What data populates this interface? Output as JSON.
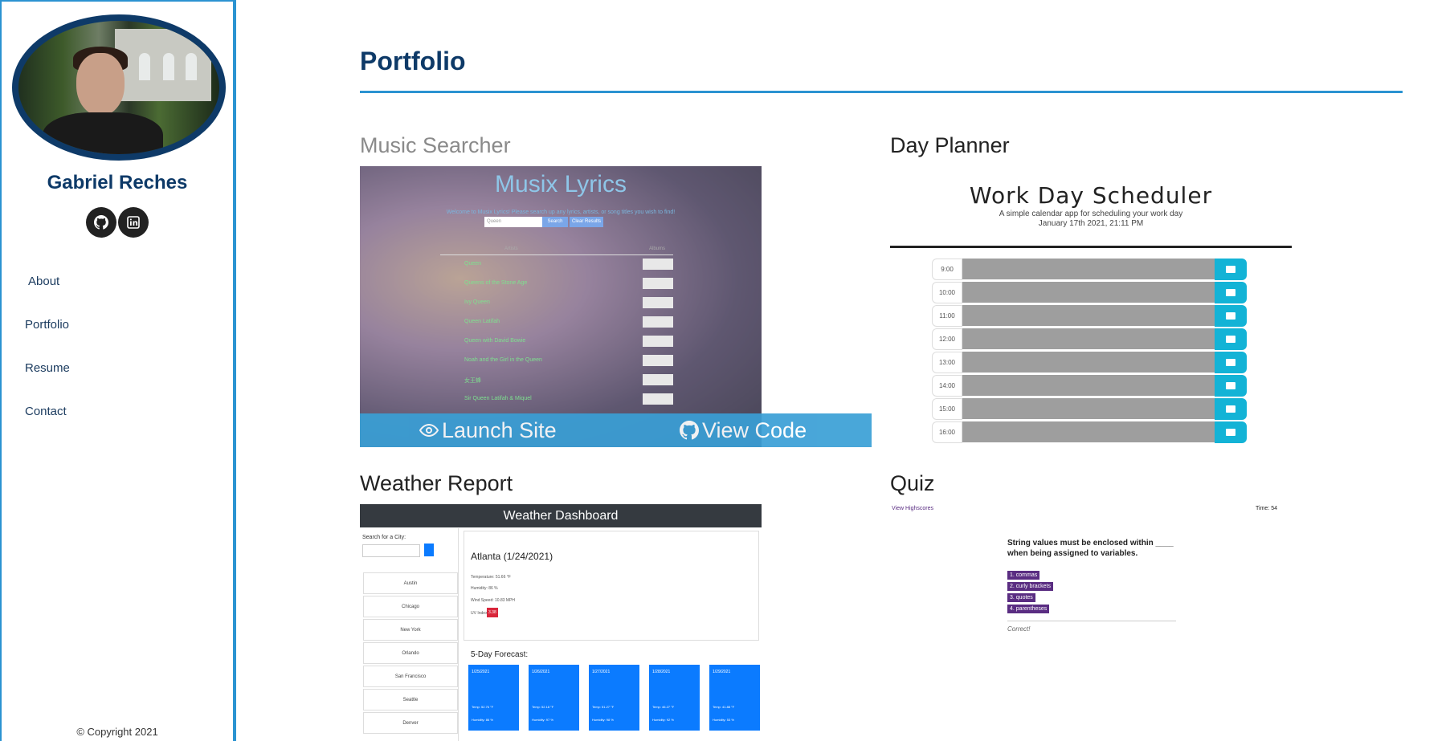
{
  "sidebar": {
    "name": "Gabriel Reches",
    "social": [
      "github-icon",
      "linkedin-icon"
    ],
    "nav": [
      {
        "label": "About"
      },
      {
        "label": "Portfolio"
      },
      {
        "label": "Resume"
      },
      {
        "label": "Contact"
      }
    ],
    "copyright": "© Copyright 2021"
  },
  "main": {
    "title": "Portfolio",
    "projects": [
      {
        "title": "Music Searcher"
      },
      {
        "title": "Day Planner"
      },
      {
        "title": "Weather Report"
      },
      {
        "title": "Quiz"
      }
    ],
    "overlay": {
      "launch_label": "Launch Site",
      "code_label": "View Code"
    }
  },
  "music_thumb": {
    "title": "Musix Lyrics",
    "intro": "Welcome to Musix Lyrics! Please search up any lyrics, artists, or song titles you wish to find!",
    "search_placeholder": "Queen",
    "search_btn": "Search",
    "clear_btn": "Clear Results",
    "col_artists": "Artists",
    "col_albums": "Albums",
    "artists": [
      "Queen",
      "Queens of the Stone Age",
      "Ivy Queen",
      "Queen Latifah",
      "Queen with David Bowie",
      "Noah and the Girl in the Queen",
      "女王蜂",
      "Sir Queen Latifah & Miquel"
    ]
  },
  "planner_thumb": {
    "title": "Work Day Scheduler",
    "subtitle": "A simple calendar app for scheduling your work day",
    "date": "January 17th 2021, 21:11 PM",
    "hours": [
      "9:00",
      "10:00",
      "11:00",
      "12:00",
      "13:00",
      "14:00",
      "15:00",
      "16:00"
    ]
  },
  "weather_thumb": {
    "header": "Weather Dashboard",
    "search_label": "Search for a City:",
    "cities": [
      "Austin",
      "Chicago",
      "New York",
      "Orlando",
      "San Francisco",
      "Seattle",
      "Denver"
    ],
    "city_title": "Atlanta (1/24/2021)",
    "temperature": "Temperature: 51.66 °F",
    "humidity": "Humidity: 86 %",
    "wind": "Wind Speed: 10.83 MPH",
    "uv_label": "UV Index:",
    "uv_value": "3.38",
    "forecast_title": "5-Day Forecast:",
    "forecast": [
      {
        "date": "1/25/2021",
        "temp": "Temp: 52.76 °F",
        "humidity": "Humidity: 86 %"
      },
      {
        "date": "1/26/2021",
        "temp": "Temp: 52.18 °F",
        "humidity": "Humidity: 97 %"
      },
      {
        "date": "1/27/2021",
        "temp": "Temp: 51.27 °F",
        "humidity": "Humidity: 98 %"
      },
      {
        "date": "1/28/2021",
        "temp": "Temp: 46.27 °F",
        "humidity": "Humidity: 92 %"
      },
      {
        "date": "1/29/2021",
        "temp": "Temp: 41.88 °F",
        "humidity": "Humidity: 53 %"
      }
    ]
  },
  "quiz_thumb": {
    "highscores": "View Highscores",
    "time": "Time: 54",
    "question": "String values must be enclosed within ____ when being assigned to variables.",
    "options": [
      "1. commas",
      "2. curly brackets",
      "3. quotes",
      "4. parentheses"
    ],
    "feedback": "Correct!"
  }
}
